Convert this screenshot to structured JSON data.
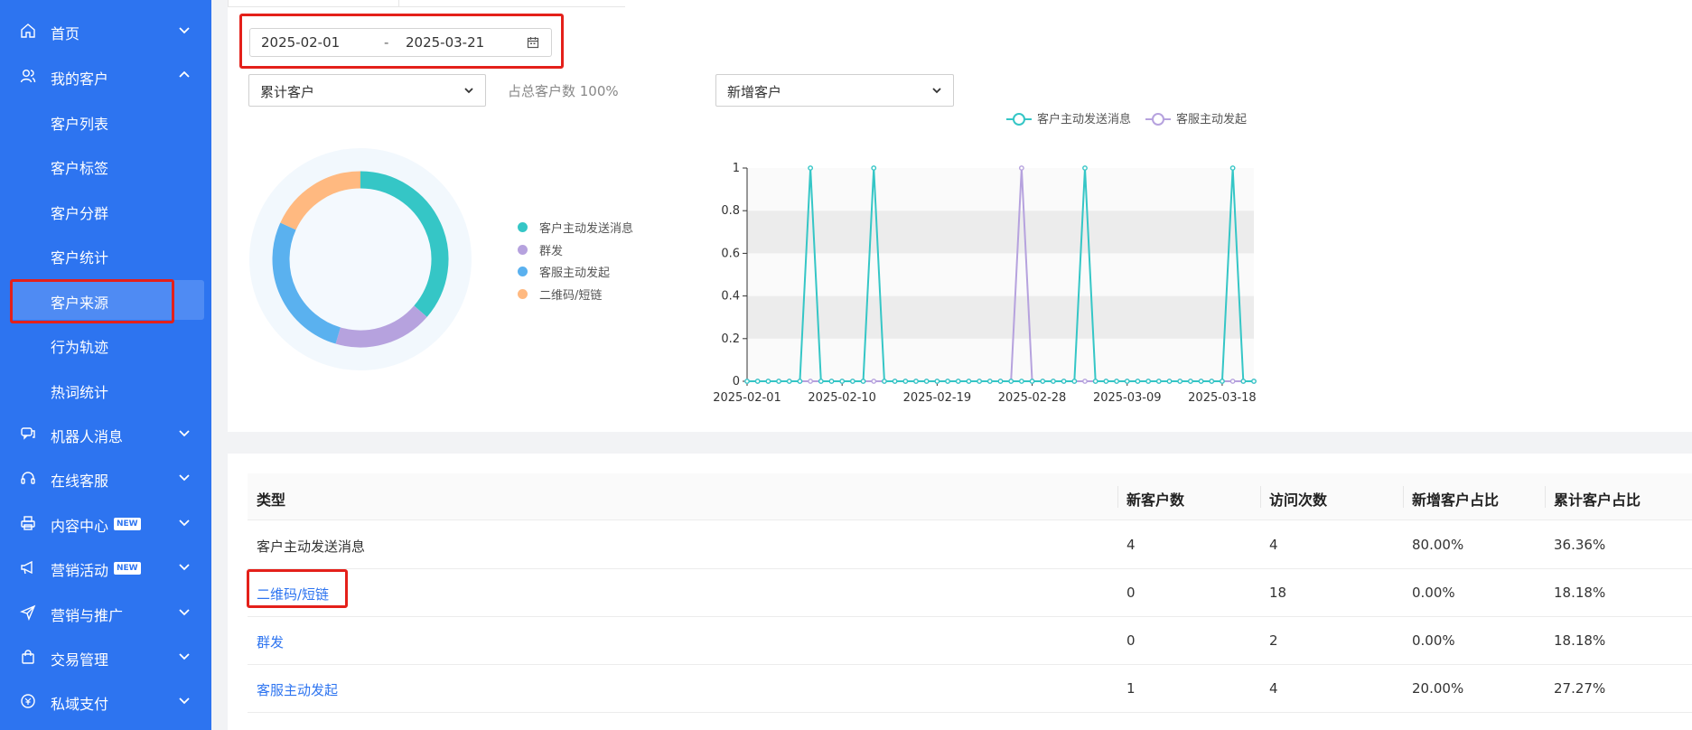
{
  "sidebar": {
    "items": [
      {
        "label": "首页",
        "icon": "home-icon"
      },
      {
        "label": "我的客户",
        "icon": "users-icon"
      },
      {
        "label": "客户列表"
      },
      {
        "label": "客户标签"
      },
      {
        "label": "客户分群"
      },
      {
        "label": "客户统计"
      },
      {
        "label": "客户来源"
      },
      {
        "label": "行为轨迹"
      },
      {
        "label": "热词统计"
      },
      {
        "label": "机器人消息",
        "icon": "robot-chat-icon"
      },
      {
        "label": "在线客服",
        "icon": "headset-icon"
      },
      {
        "label": "内容中心",
        "icon": "printer-icon",
        "badge": "NEW"
      },
      {
        "label": "营销活动",
        "icon": "megaphone-icon",
        "badge": "NEW"
      },
      {
        "label": "营销与推广",
        "icon": "send-icon"
      },
      {
        "label": "交易管理",
        "icon": "bag-icon"
      },
      {
        "label": "私域支付",
        "icon": "coin-icon"
      }
    ]
  },
  "filters": {
    "date_start": "2025-02-01",
    "date_sep": "-",
    "date_end": "2025-03-21",
    "left_select": "累计客户",
    "ratio_text": "占总客户数 100%",
    "right_select": "新增客户"
  },
  "donut_legend": [
    {
      "label": "客户主动发送消息",
      "color": "#35c6c6"
    },
    {
      "label": "群发",
      "color": "#b6a2de"
    },
    {
      "label": "客服主动发起",
      "color": "#5ab1ef"
    },
    {
      "label": "二维码/短链",
      "color": "#ffb980"
    }
  ],
  "colors": {
    "sidebar": "#2d74f0",
    "teal": "#35c6c6",
    "purple": "#b6a2de",
    "blue": "#5ab1ef",
    "orange": "#ffb980",
    "highlight": "#e4201a"
  },
  "chart_data": [
    {
      "type": "pie",
      "categories": [
        "客户主动发送消息",
        "群发",
        "客服主动发起",
        "二维码/短链"
      ],
      "values": [
        36.36,
        18.18,
        27.27,
        18.18
      ],
      "legend": "right"
    },
    {
      "type": "line",
      "legend_labels": [
        "客户主动发送消息",
        "客服主动发起"
      ],
      "x_tick_labels": [
        "2025-02-01",
        "2025-02-10",
        "2025-02-19",
        "2025-02-28",
        "2025-03-09",
        "2025-03-18"
      ],
      "x_start": "2025-02-01",
      "x_end": "2025-03-21",
      "y_ticks": [
        "0",
        "0.2",
        "0.4",
        "0.6",
        "0.8",
        "1"
      ],
      "ylim": [
        0,
        1
      ],
      "series": [
        {
          "name": "客户主动发送消息",
          "color": "#35c6c6",
          "spike_dates": [
            "2025-02-07",
            "2025-02-13",
            "2025-03-05",
            "2025-03-19"
          ]
        },
        {
          "name": "客服主动发起",
          "color": "#b6a2de",
          "spike_dates": [
            "2025-02-27"
          ]
        }
      ],
      "legend": "top-right"
    }
  ],
  "table": {
    "headers": [
      "类型",
      "新客户数",
      "访问次数",
      "新增客户占比",
      "累计客户占比"
    ],
    "rows": [
      {
        "type": "客户主动发送消息",
        "new": "4",
        "visits": "4",
        "new_ratio": "80.00%",
        "cum_ratio": "36.36%"
      },
      {
        "type": "二维码/短链",
        "new": "0",
        "visits": "18",
        "new_ratio": "0.00%",
        "cum_ratio": "18.18%"
      },
      {
        "type": "群发",
        "new": "0",
        "visits": "2",
        "new_ratio": "0.00%",
        "cum_ratio": "18.18%"
      },
      {
        "type": "客服主动发起",
        "new": "1",
        "visits": "4",
        "new_ratio": "20.00%",
        "cum_ratio": "27.27%"
      }
    ]
  }
}
